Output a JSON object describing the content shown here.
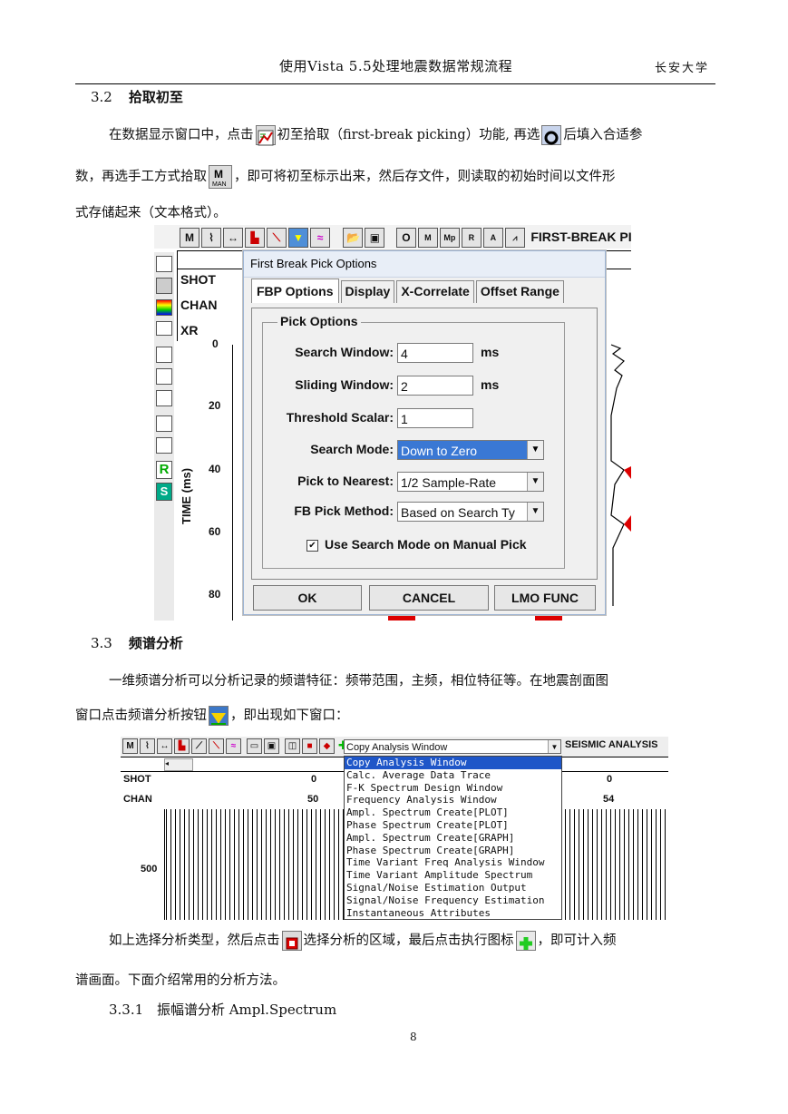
{
  "header": {
    "title": "使用Vista 5.5处理地震数据常规流程",
    "university": "长安大学"
  },
  "sections": {
    "s32": {
      "num": "3.2",
      "title": "拾取初至"
    },
    "s33": {
      "num": "3.3",
      "title": "频谱分析"
    },
    "s331": {
      "num": "3.3.1",
      "title": "振幅谱分析 Ampl.Spectrum"
    }
  },
  "paragraphs": {
    "p1a": "在数据显示窗口中，点击",
    "p1b": "初至拾取（first-break picking）功能, 再选",
    "p1c": "后填入合适参",
    "p2a": "数，再选手工方式拾取",
    "p2b": "，即可将初至标示出来，然后存文件，则读取的初始时间以文件形",
    "p3": "式存储起来（文本格式）。",
    "p4": "一维频谱分析可以分析记录的频谱特征：频带范围，主频，相位特征等。在地震剖面图",
    "p5a": "窗口点击频谱分析按钮",
    "p5b": "，即出现如下窗口：",
    "p6a": "如上选择分析类型，然后点击",
    "p6b": "选择分析的区域，最后点击执行图标",
    "p6c": "，即可计入频",
    "p7": "谱画面。下面介绍常用的分析方法。"
  },
  "fig1": {
    "toolbar_title": "FIRST-BREAK PICK",
    "side_labels": [
      "SHOT",
      "CHAN",
      "XR"
    ],
    "axis_label": "TIME (ms)",
    "ticks": [
      "0",
      "20",
      "40",
      "60",
      "80"
    ],
    "dialog": {
      "title": "First Break Pick Options",
      "tabs": [
        "FBP Options",
        "Display",
        "X-Correlate",
        "Offset Range"
      ],
      "group": "Pick Options",
      "search_window_label": "Search Window:",
      "search_window_value": "4",
      "search_window_unit": "ms",
      "sliding_window_label": "Sliding Window:",
      "sliding_window_value": "2",
      "sliding_window_unit": "ms",
      "threshold_label": "Threshold Scalar:",
      "threshold_value": "1",
      "search_mode_label": "Search Mode:",
      "search_mode_value": "Down to Zero",
      "pick_nearest_label": "Pick to Nearest:",
      "pick_nearest_value": "1/2 Sample-Rate",
      "fb_method_label": "FB Pick Method:",
      "fb_method_value": "Based on Search Ty",
      "checkbox_label": "Use Search Mode on Manual Pick",
      "ok": "OK",
      "cancel": "CANCEL",
      "lmo": "LMO FUNC"
    }
  },
  "fig2": {
    "title": "SEISMIC ANALYSIS",
    "dropdown_value": "Copy Analysis Window",
    "options": [
      "Copy Analysis Window",
      "Calc. Average Data Trace",
      "F-K Spectrum Design Window",
      "Frequency Analysis Window",
      "Ampl. Spectrum Create[PLOT]",
      "Phase Spectrum Create[PLOT]",
      "Ampl. Spectrum Create[GRAPH]",
      "Phase Spectrum Create[GRAPH]",
      "Time Variant Freq Analysis Window",
      "Time Variant Amplitude Spectrum",
      "Signal/Noise Estimation Output",
      "Signal/Noise Frequency Estimation",
      "Instantaneous Attributes"
    ],
    "shot_label": "SHOT",
    "chan_label": "CHAN",
    "shot_left": "0",
    "chan_left": "50",
    "shot_right": "0",
    "chan_right": "54",
    "tick": "500"
  },
  "page_number": "8"
}
